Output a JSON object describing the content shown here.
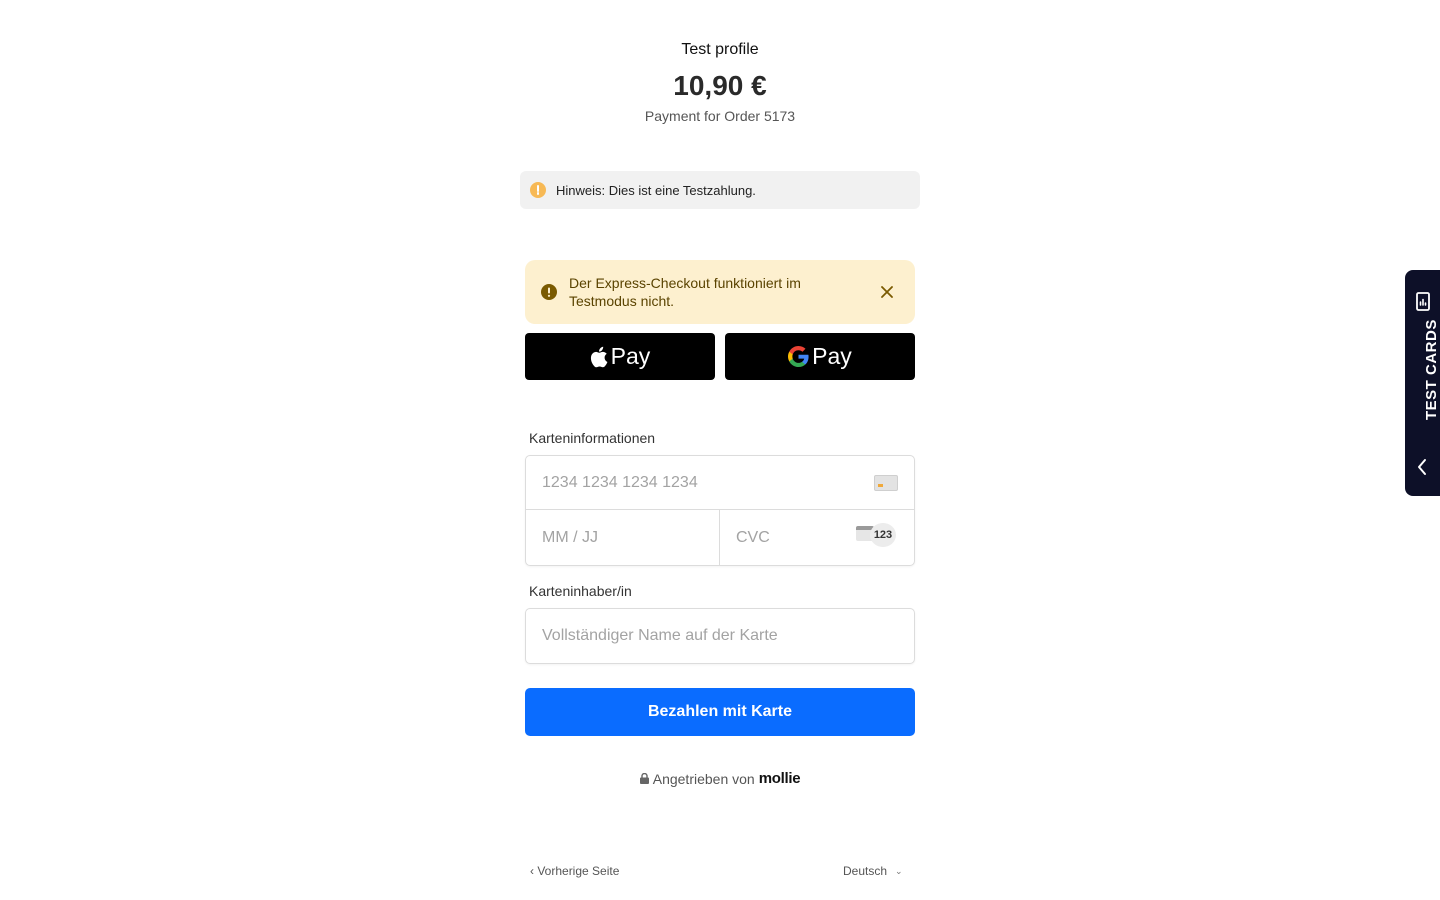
{
  "header": {
    "merchant": "Test profile",
    "amount": "10,90 €",
    "description": "Payment for Order 5173"
  },
  "notice": {
    "text": "Hinweis: Dies ist eine Testzahlung.",
    "icon": "info-icon"
  },
  "warning": {
    "text": "Der Express-Checkout funktioniert im Testmodus nicht.",
    "icon": "alert-circle-icon",
    "close_icon": "close-icon"
  },
  "wallets": {
    "apple_pay_label": "Pay",
    "google_pay_label": "Pay"
  },
  "card": {
    "section_label": "Karteninformationen",
    "number_placeholder": "1234 1234 1234 1234",
    "expiry_placeholder": "MM / JJ",
    "cvc_placeholder": "CVC",
    "cvc_badge": "123",
    "holder_label": "Karteninhaber/in",
    "holder_placeholder": "Vollständiger Name auf der Karte"
  },
  "submit_label": "Bezahlen mit Karte",
  "powered": {
    "text": "Angetrieben von",
    "brand": "mollie"
  },
  "footer": {
    "back_label": "‹ Vorherige Seite",
    "language": "Deutsch"
  },
  "test_cards": {
    "label": "TEST CARDS"
  },
  "colors": {
    "primary": "#0a6cff",
    "warning_bg": "#fdf0cf",
    "notice_bg": "#f1f1f1",
    "sidebar_bg": "#0d1028"
  }
}
